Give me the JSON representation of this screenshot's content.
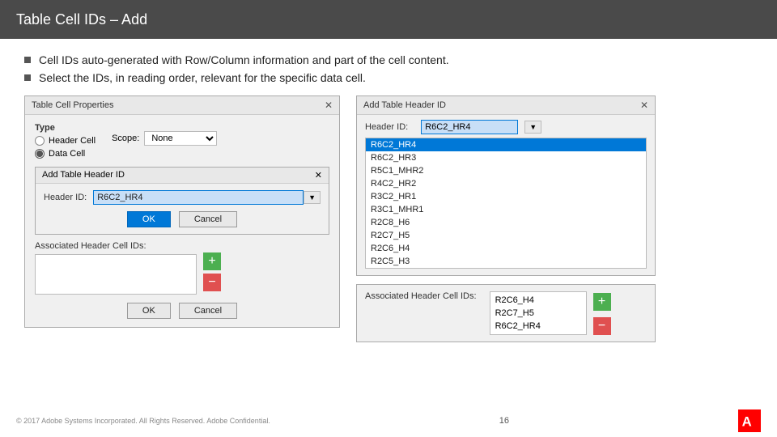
{
  "header": {
    "title": "Table Cell IDs – Add"
  },
  "bullets": [
    "Cell IDs auto-generated with Row/Column information and part of the cell content.",
    "Select the IDs, in reading order, relevant for the specific data cell."
  ],
  "left_dialog": {
    "title": "Table Cell Properties",
    "type_label": "Type",
    "radio_header": "Header Cell",
    "radio_data": "Data Cell",
    "scope_label": "Scope:",
    "scope_value": "None",
    "inner_dialog_title": "Add Table Header ID",
    "header_id_label": "Header ID:",
    "header_id_value": "R6C2_HR4",
    "ok_label": "OK",
    "cancel_label": "Cancel",
    "assoc_label": "Associated Header Cell IDs:",
    "bottom_ok": "OK",
    "bottom_cancel": "Cancel"
  },
  "right_top_dialog": {
    "title": "Add Table Header ID",
    "header_id_label": "Header ID:",
    "header_id_value": "R6C2_HR4",
    "list_items": [
      {
        "value": "R6C2_HR4",
        "selected": true
      },
      {
        "value": "R6C2_HR3"
      },
      {
        "value": "R5C1_MHR2"
      },
      {
        "value": "R4C2_HR2"
      },
      {
        "value": "R3C2_HR1"
      },
      {
        "value": "R3C1_MHR1"
      },
      {
        "value": "R2C8_H6"
      },
      {
        "value": "R2C7_H5"
      },
      {
        "value": "R2C6_H4"
      },
      {
        "value": "R2C5_H3"
      }
    ]
  },
  "right_assoc": {
    "label": "Associated Header Cell IDs:",
    "items": [
      "R2C6_H4",
      "R2C7_H5",
      "R6C2_HR4"
    ],
    "add_btn": "+",
    "remove_btn": "−"
  },
  "footer": {
    "copyright": "© 2017 Adobe Systems Incorporated. All Rights Reserved. Adobe Confidential.",
    "page": "16"
  }
}
